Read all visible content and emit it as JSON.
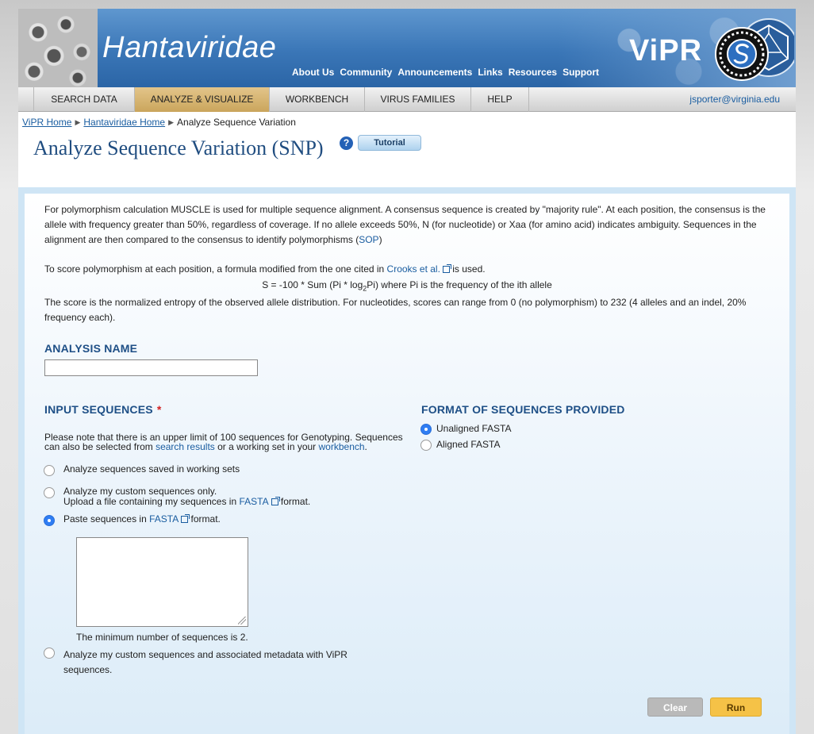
{
  "banner": {
    "title": "Hantaviridae",
    "links": [
      "About Us",
      "Community",
      "Announcements",
      "Links",
      "Resources",
      "Support"
    ],
    "logo_text": "ViPR"
  },
  "nav": {
    "items": [
      "SEARCH DATA",
      "ANALYZE & VISUALIZE",
      "WORKBENCH",
      "VIRUS FAMILIES",
      "HELP"
    ],
    "active": "ANALYZE & VISUALIZE",
    "user_email": "jsporter@virginia.edu"
  },
  "breadcrumb": [
    "ViPR Home",
    "Hantaviridae Home",
    "Analyze Sequence Variation"
  ],
  "page": {
    "title": "Analyze Sequence Variation (SNP)",
    "help_icon_text": "?",
    "tutorial_label": "Tutorial"
  },
  "intro": {
    "p1_text": "For polymorphism calculation MUSCLE is used for multiple sequence alignment. A consensus sequence is created by \"majority rule\". At each position, the consensus is the allele with frequency greater than 50%, regardless of coverage. If no allele exceeds 50%, N (for nucleotide) or Xaa (for amino acid) indicates ambiguity. Sequences in the alignment are then compared to the consensus to identify polymorphisms (",
    "p1_link": "SOP",
    "p1_end": ")",
    "p2_before": "To score polymorphism at each position, a formula modified from the one cited in ",
    "p2_link": "Crooks et al.",
    "p2_after": " is used.",
    "formula_a": "S = -100 * Sum (Pi * log",
    "formula_sub": "2",
    "formula_b": "Pi) where Pi is the frequency of the ith allele",
    "p3": "The score is the normalized entropy of the observed allele distribution. For nucleotides, scores can range from 0 (no polymorphism) to 232 (4 alleles and an indel, 20% frequency each)."
  },
  "analysis_name": {
    "heading": "ANALYSIS NAME",
    "value": ""
  },
  "input_sequences": {
    "heading": "INPUT SEQUENCES",
    "required_mark": "*",
    "note_a": "Please note that there is an upper limit of 100 sequences for Genotyping. Sequences can also be selected from ",
    "note_link1": "search results",
    "note_b": " or a working set in your ",
    "note_link2": "workbench",
    "note_c": ".",
    "options": {
      "working_sets": "Analyze sequences saved in working sets",
      "custom_line1": "Analyze my custom sequences only.",
      "custom_line2a": "Upload a file containing my sequences in ",
      "fasta_link": "FASTA",
      "format_word": " format.",
      "paste_a": "Paste sequences in ",
      "paste_b": " format.",
      "metadata_line1": "Analyze my custom sequences and associated metadata with ViPR",
      "metadata_line2": "sequences."
    },
    "selected": "paste",
    "textarea_value": "",
    "min_note": "The minimum number of sequences is 2."
  },
  "format": {
    "heading": "FORMAT OF SEQUENCES PROVIDED",
    "options": [
      "Unaligned FASTA",
      "Aligned FASTA"
    ],
    "selected": "Unaligned FASTA"
  },
  "buttons": {
    "clear": "Clear",
    "run": "Run"
  }
}
